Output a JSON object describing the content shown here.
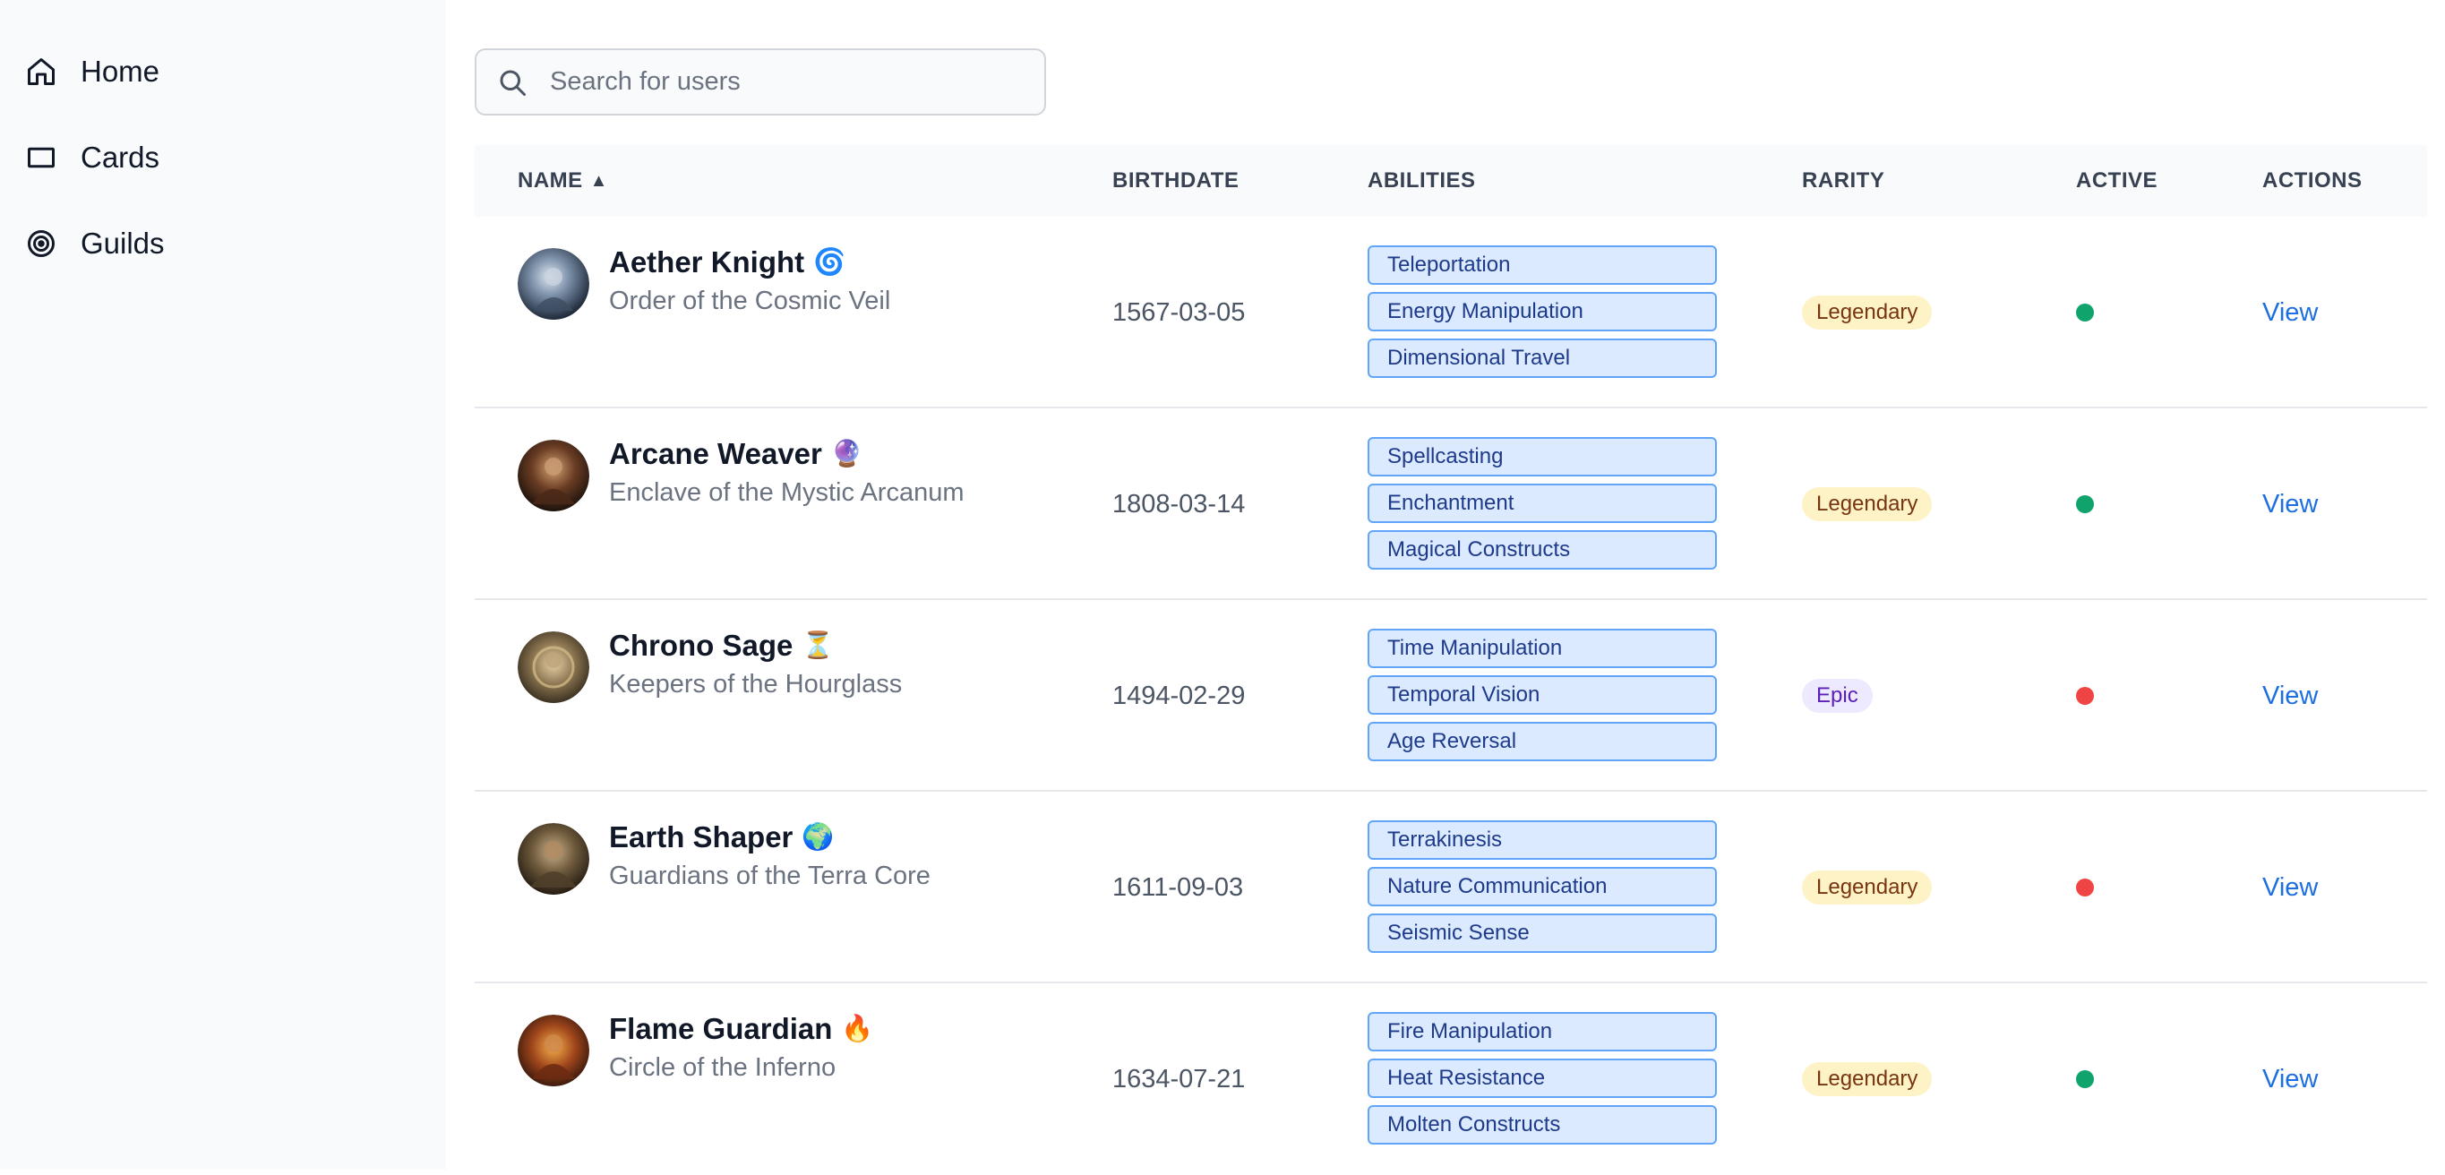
{
  "sidebar": {
    "items": [
      {
        "label": "Home",
        "icon": "home-icon"
      },
      {
        "label": "Cards",
        "icon": "rectangle-icon"
      },
      {
        "label": "Guilds",
        "icon": "target-icon"
      }
    ]
  },
  "search": {
    "placeholder": "Search for users",
    "value": ""
  },
  "table": {
    "headers": {
      "name": "NAME",
      "name_sort": "▲",
      "birthdate": "BIRTHDATE",
      "abilities": "ABILITIES",
      "rarity": "RARITY",
      "active": "ACTIVE",
      "actions": "ACTIONS"
    },
    "rows": [
      {
        "name": "Aether Knight",
        "emoji": "🌀",
        "guild": "Order of the Cosmic Veil",
        "birthdate": "1567-03-05",
        "abilities": [
          "Teleportation",
          "Energy Manipulation",
          "Dimensional Travel"
        ],
        "rarity": "Legendary",
        "active": true,
        "action": "View"
      },
      {
        "name": "Arcane Weaver",
        "emoji": "🔮",
        "guild": "Enclave of the Mystic Arcanum",
        "birthdate": "1808-03-14",
        "abilities": [
          "Spellcasting",
          "Enchantment",
          "Magical Constructs"
        ],
        "rarity": "Legendary",
        "active": true,
        "action": "View"
      },
      {
        "name": "Chrono Sage",
        "emoji": "⏳",
        "guild": "Keepers of the Hourglass",
        "birthdate": "1494-02-29",
        "abilities": [
          "Time Manipulation",
          "Temporal Vision",
          "Age Reversal"
        ],
        "rarity": "Epic",
        "active": false,
        "action": "View"
      },
      {
        "name": "Earth Shaper",
        "emoji": "🌍",
        "guild": "Guardians of the Terra Core",
        "birthdate": "1611-09-03",
        "abilities": [
          "Terrakinesis",
          "Nature Communication",
          "Seismic Sense"
        ],
        "rarity": "Legendary",
        "active": false,
        "action": "View"
      },
      {
        "name": "Flame Guardian",
        "emoji": "🔥",
        "guild": "Circle of the Inferno",
        "birthdate": "1634-07-21",
        "abilities": [
          "Fire Manipulation",
          "Heat Resistance",
          "Molten Constructs"
        ],
        "rarity": "Legendary",
        "active": true,
        "action": "View"
      }
    ]
  },
  "colors": {
    "active": "#10a36b",
    "inactive": "#ef4444",
    "link": "#1d6fe0",
    "legendary_bg": "#fef3c7",
    "epic_bg": "#ede9fe",
    "ability_bg": "#dbeafe",
    "ability_border": "#60a5fa"
  }
}
